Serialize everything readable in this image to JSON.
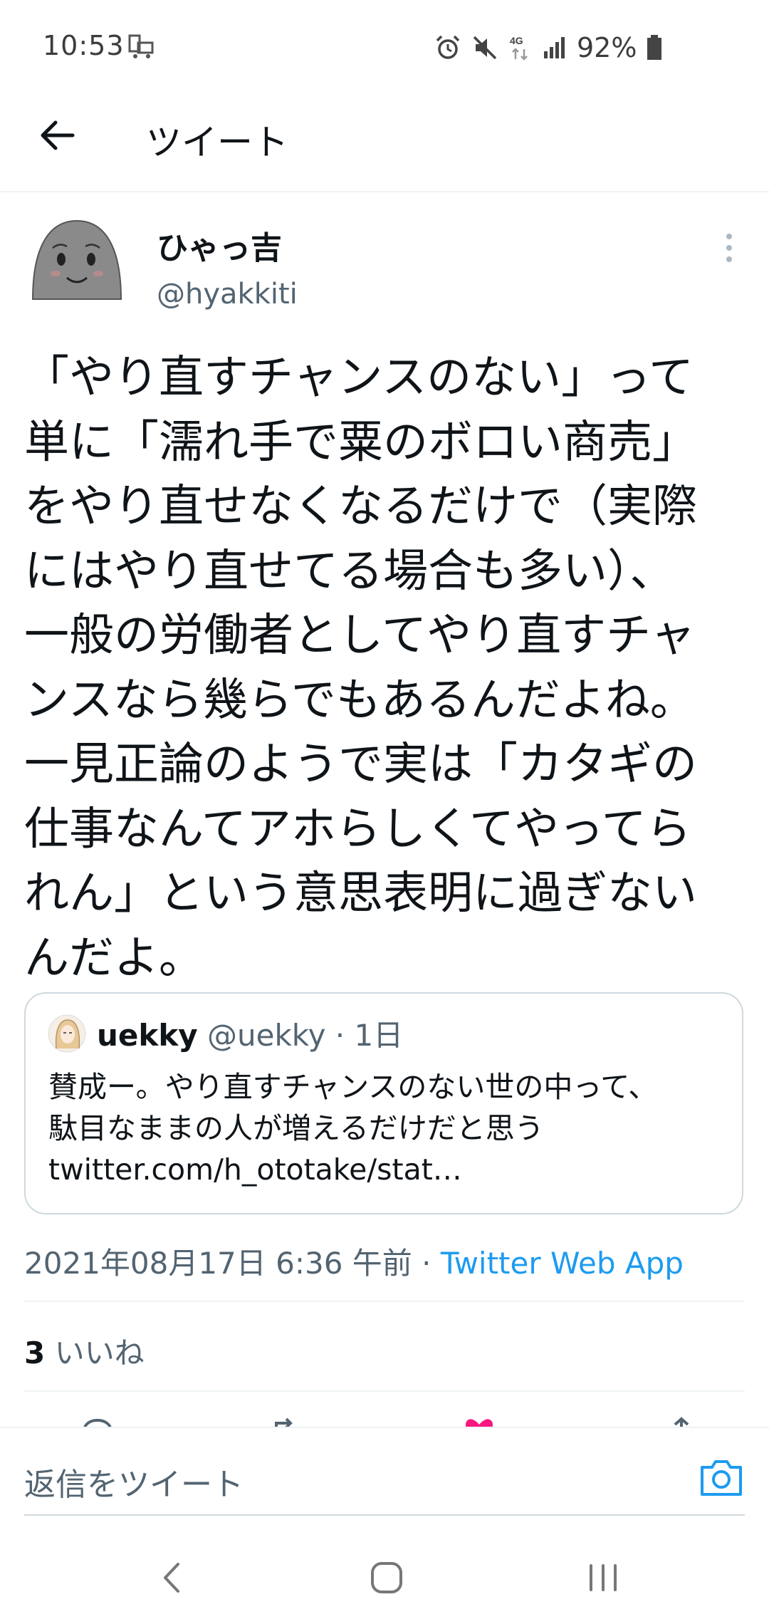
{
  "status_bar": {
    "time": "10:53",
    "battery": "92%",
    "network": "4G"
  },
  "header": {
    "title": "ツイート"
  },
  "tweet": {
    "author_name": "ひゃっ吉",
    "author_handle": "@hyakkiti",
    "text": "「やり直すチャンスのない」って\n単に「濡れ手で粟のボロい商売」\nをやり直せなくなるだけで（実際\nにはやり直せてる場合も多い）、\n一般の労働者としてやり直すチャ\nンスなら幾らでもあるんだよね。\n一見正論のようで実は「カタギの\n仕事なんてアホらしくてやってら\nれん」という意思表明に過ぎない\nんだよ。",
    "timestamp": "2021年08月17日 6:36 午前",
    "separator": " · ",
    "source": "Twitter Web App",
    "likes_count": "3",
    "likes_label": "いいね"
  },
  "quote": {
    "name": "uekky",
    "meta": " @uekky · 1日",
    "text": "賛成ー。やり直すチャンスのない世の中って、\n駄目なままの人が増えるだけだと思う\ntwitter.com/h_ototake/stat…"
  },
  "reply": {
    "placeholder": "返信をツイート"
  },
  "colors": {
    "accent": "#1d9bf0",
    "text": "#0f1419",
    "secondary": "#536471",
    "like": "#f91880"
  }
}
